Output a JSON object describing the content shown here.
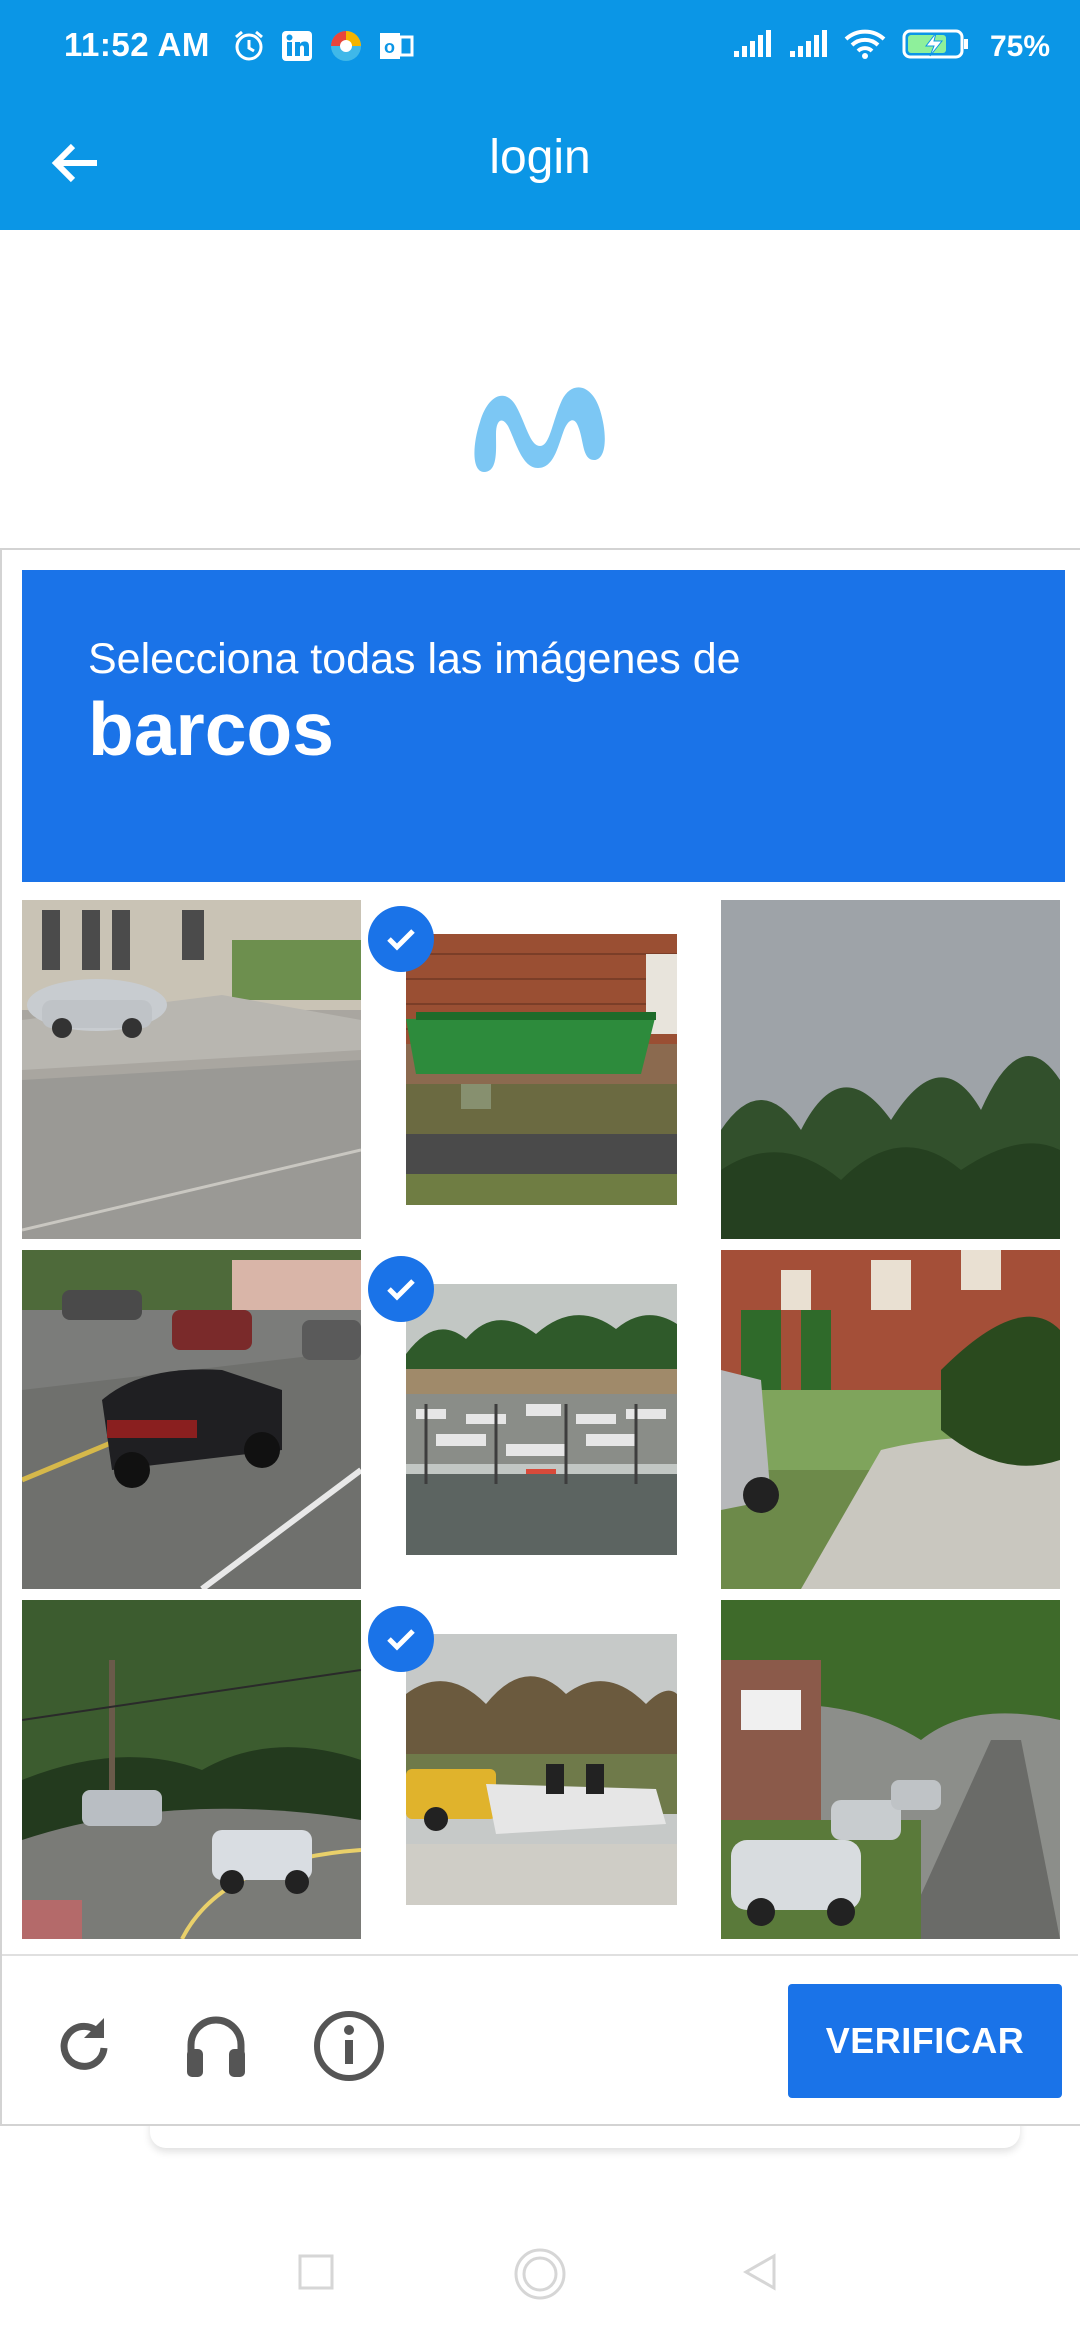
{
  "status_bar": {
    "time": "11:52 AM",
    "battery_percent": "75%",
    "left_icons": [
      "alarm-icon",
      "linkedin-icon",
      "edge-browser-icon",
      "outlook-icon"
    ],
    "right_icons": [
      "signal-icon",
      "signal-icon-2",
      "wifi-icon",
      "battery-charging-icon"
    ]
  },
  "app_bar": {
    "title": "login",
    "back_icon": "arrow-left-icon",
    "color": "#0b96e6"
  },
  "logo": {
    "name": "movistar-logo-icon",
    "color": "#7cc7f4"
  },
  "captcha": {
    "instruction": "Selecciona todas las imágenes de",
    "target": "barcos",
    "header_color": "#1a73e8",
    "tiles": [
      {
        "id": 1,
        "subject": "street with parked car",
        "selected": false
      },
      {
        "id": 2,
        "subject": "green boat",
        "selected": true
      },
      {
        "id": 3,
        "subject": "sky and pine trees",
        "selected": false
      },
      {
        "id": 4,
        "subject": "car on road",
        "selected": false
      },
      {
        "id": 5,
        "subject": "marina with boats",
        "selected": true
      },
      {
        "id": 6,
        "subject": "brick house and suv",
        "selected": false
      },
      {
        "id": 7,
        "subject": "road with cars and trees",
        "selected": false
      },
      {
        "id": 8,
        "subject": "pickup towing boat",
        "selected": true
      },
      {
        "id": 9,
        "subject": "tree-lined street with cars",
        "selected": false
      }
    ],
    "footer": {
      "icons": [
        "reload-icon",
        "headphones-icon",
        "info-icon"
      ],
      "verify_label": "VERIFICAR"
    }
  },
  "nav_bar": {
    "icons": [
      "recents-square-icon",
      "home-circle-icon",
      "back-triangle-icon"
    ]
  }
}
